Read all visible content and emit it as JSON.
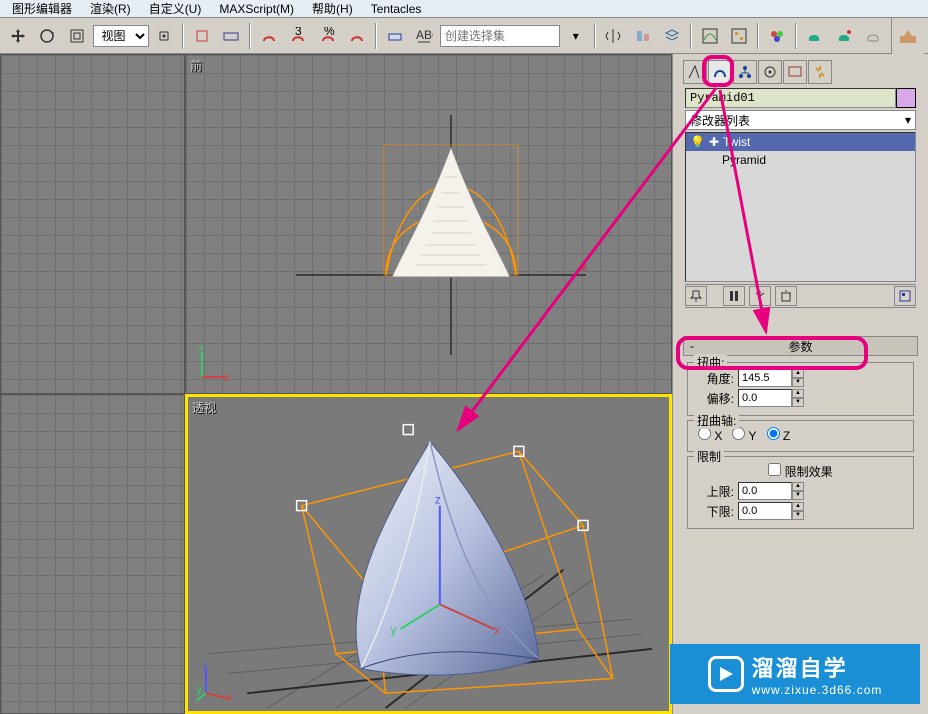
{
  "menu": {
    "shape_editor": "图形编辑器",
    "render": "渲染(R)",
    "customize": "自定义(U)",
    "maxscript": "MAXScript(M)",
    "help": "帮助(H)",
    "tentacles": "Tentacles"
  },
  "toolbar": {
    "view_combo": "视图",
    "selset_placeholder": "创建选择集"
  },
  "viewports": {
    "front": "前",
    "perspective": "透视"
  },
  "panel": {
    "object_name": "Pyramid01",
    "mod_list_label": "修改器列表",
    "mod_twist": "Twist",
    "mod_pyramid": "Pyramid"
  },
  "rollout": {
    "title": "参数",
    "bend_group": "扭曲:",
    "angle_label": "角度:",
    "angle_value": "145.5",
    "bias_label": "偏移:",
    "bias_value": "0.0",
    "axis_group": "扭曲轴:",
    "axis_x": "X",
    "axis_y": "Y",
    "axis_z": "Z",
    "limit_group": "限制",
    "limit_effect": "限制效果",
    "upper_label": "上限:",
    "upper_value": "0.0",
    "lower_label": "下限:",
    "lower_value": "0.0"
  },
  "watermark": {
    "title": "溜溜自学",
    "url": "www.zixue.3d66.com"
  },
  "axes": {
    "x": "x",
    "y": "y",
    "z": "z"
  }
}
